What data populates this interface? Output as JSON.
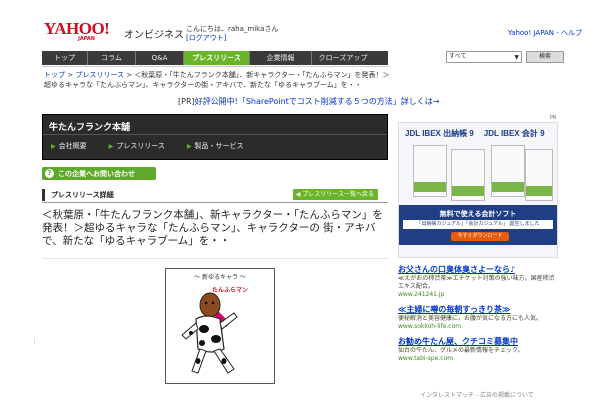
{
  "header": {
    "logo": "YAHOO!",
    "logo_sub": "JAPAN",
    "site_name": "オンビジネス",
    "greeting": "こんにちは、raha_mikaさん",
    "logout": "[ログアウト]",
    "top_links": "Yahoo! JAPAN - ヘルプ"
  },
  "nav": {
    "items": [
      "トップ",
      "コラム",
      "Q&A",
      "プレスリリース",
      "企業情報",
      "クローズアップ"
    ],
    "active_index": 3
  },
  "search": {
    "select_value": "すべて",
    "button_label": "検索"
  },
  "breadcrumb": {
    "items": [
      "トップ",
      "プレスリリース"
    ],
    "separator": " > ",
    "current": "＜秋葉原・「牛たんフランク本舗」、新キャラクター・「たんふらマン」を発表！＞超ゆるキャラな「たんふらマン」、キャラクターの街・アキバで、新たな「ゆるキャラブーム」を・・"
  },
  "pr_line": {
    "prefix": "[PR]",
    "link": "好評公開中!「SharePointでコスト削減する５つの方法」詳しくは→"
  },
  "company": {
    "name": "牛たんフランク本舗",
    "links": [
      "会社概要",
      "プレスリリース",
      "製品・サービス"
    ]
  },
  "inquiry": {
    "icon": "?",
    "label": "この企業へお問い合わせ"
  },
  "section": {
    "title": "プレスリリース詳細",
    "back_button": "プレスリリース一覧へ戻る"
  },
  "headline": "＜秋葉原・「牛たんフランク本舗」、新キャラクター・「たんふらマン」を発表！＞超ゆるキャラな「たんふらマン」、キャラクターの 街・アキバで、新たな「ゆるキャラブーム」を・・",
  "image": {
    "title": "〜 新ゆるキャラ 〜",
    "label": "たんふらマン"
  },
  "right": {
    "pr_tag": "PR",
    "banner": {
      "title1": "JDL IBEX 出納帳 9",
      "title2": "JDL IBEX 会計 9",
      "free_title": "無料で使える会計ソフト",
      "free_sub": "「出納帳カジュアル」「会計カジュアル」 誕生しました",
      "download": "今すぐダウンロード"
    },
    "text_ads": [
      {
        "head": "お父さんの口臭体臭さよーなら♪",
        "body": "≪えがおの柿渋茶≫エチケット対策の強い味方。国産柿渋エキス配合。",
        "url": "www.241241.jp"
      },
      {
        "head": "≪主婦に噂の毎朝すっきり茶≫",
        "body": "便秘解消と美容健康に。お腹が気になる方にも人気。",
        "url": "www.sokkoh-life.com"
      },
      {
        "head": "お勧め牛たん屋、クチコミ募集中",
        "body": "仙台の牛たん、グルメの最新情報をチェック。",
        "url": "www.tabi-spe.com"
      }
    ],
    "footer": "インタレストマッチ - 広告の掲載について"
  }
}
